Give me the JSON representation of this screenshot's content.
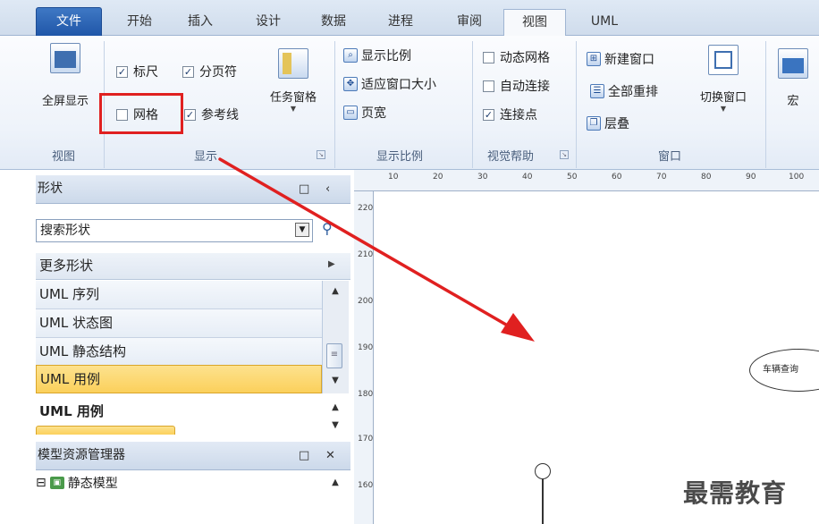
{
  "tabs": [
    {
      "label": "文件"
    },
    {
      "label": "开始"
    },
    {
      "label": "插入"
    },
    {
      "label": "设计"
    },
    {
      "label": "数据"
    },
    {
      "label": "进程"
    },
    {
      "label": "审阅"
    },
    {
      "label": "视图"
    },
    {
      "label": "UML"
    }
  ],
  "ribbon": {
    "view_group": {
      "label": "视图",
      "fullscreen": "全屏显示"
    },
    "show_group": {
      "label": "显示",
      "ruler": {
        "label": "标尺",
        "checked": true
      },
      "pagebreak": {
        "label": "分页符",
        "checked": true
      },
      "grid": {
        "label": "网格",
        "checked": false
      },
      "guides": {
        "label": "参考线",
        "checked": true
      },
      "task_pane": "任务窗格"
    },
    "zoom_group": {
      "label": "显示比例",
      "zoom": "显示比例",
      "fit": "适应窗口大小",
      "page_width": "页宽"
    },
    "visual_aids": {
      "label": "视觉帮助",
      "dynamic_grid": {
        "label": "动态网格",
        "checked": false
      },
      "auto_connect": {
        "label": "自动连接",
        "checked": false
      },
      "connection_points": {
        "label": "连接点",
        "checked": true
      }
    },
    "window_group": {
      "label": "窗口",
      "new_window": "新建窗口",
      "arrange_all": "全部重排",
      "cascade": "层叠",
      "switch": "切换窗口"
    },
    "macros": {
      "label": "宏"
    }
  },
  "shapes_panel": {
    "title": "形状",
    "search_placeholder": "搜索形状",
    "more_shapes": "更多形状",
    "stencils": [
      "UML 序列",
      "UML 状态图",
      "UML 静态结构",
      "UML 用例"
    ],
    "selected_stencil": "UML 用例",
    "stencil_title": "UML 用例"
  },
  "model_explorer": {
    "title": "模型资源管理器",
    "root": "静态模型"
  },
  "ruler": {
    "h_ticks": [
      "10",
      "20",
      "30",
      "40",
      "50",
      "60",
      "70",
      "80",
      "90",
      "100"
    ],
    "v_ticks": [
      "220",
      "210",
      "200",
      "190",
      "180",
      "170",
      "160"
    ]
  },
  "canvas": {
    "usecase_text": "车辆查询"
  },
  "watermark": "最需教育"
}
